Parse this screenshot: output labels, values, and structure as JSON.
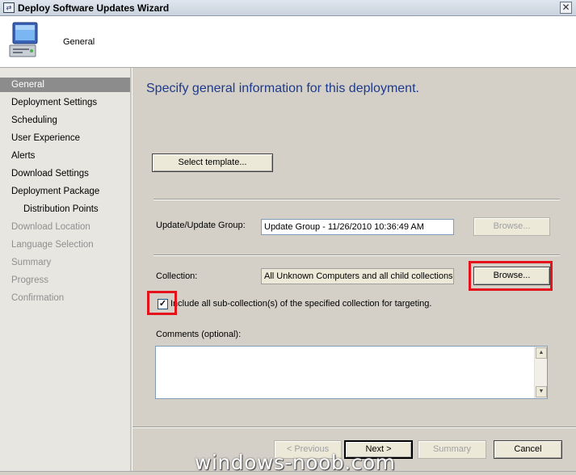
{
  "window": {
    "title": "Deploy Software Updates Wizard",
    "close_glyph": "✕",
    "header_section": "General"
  },
  "nav": {
    "items": [
      {
        "label": "General",
        "state": "active"
      },
      {
        "label": "Deployment Settings",
        "state": "enabled"
      },
      {
        "label": "Scheduling",
        "state": "enabled"
      },
      {
        "label": "User Experience",
        "state": "enabled"
      },
      {
        "label": "Alerts",
        "state": "enabled"
      },
      {
        "label": "Download Settings",
        "state": "enabled"
      },
      {
        "label": "Deployment Package",
        "state": "enabled"
      },
      {
        "label": "Distribution Points",
        "state": "enabled-sub"
      },
      {
        "label": "Download Location",
        "state": "disabled"
      },
      {
        "label": "Language Selection",
        "state": "disabled"
      },
      {
        "label": "Summary",
        "state": "disabled"
      },
      {
        "label": "Progress",
        "state": "disabled"
      },
      {
        "label": "Confirmation",
        "state": "disabled"
      }
    ]
  },
  "main": {
    "heading": "Specify general information for this deployment.",
    "select_template_label": "Select template...",
    "update_group_label": "Update/Update Group:",
    "update_group_value": "Update Group - 11/26/2010 10:36:49 AM",
    "browse_update_label": "Browse...",
    "collection_label": "Collection:",
    "collection_value": "All Unknown Computers and all child collections",
    "browse_collection_label": "Browse...",
    "include_subcollections_label": "Include all sub-collection(s) of the specified collection for targeting.",
    "include_subcollections_checked": true,
    "comments_label": "Comments (optional):",
    "comments_value": ""
  },
  "footer": {
    "previous_label": "< Previous",
    "next_label": "Next >",
    "summary_label": "Summary",
    "cancel_label": "Cancel"
  },
  "watermark": "windows-noob.com",
  "colors": {
    "highlight_red": "#e3121b",
    "heading_blue": "#1e3a8a",
    "nav_active_bg": "#8c8c8c",
    "dialog_bg": "#d4d0c8"
  }
}
